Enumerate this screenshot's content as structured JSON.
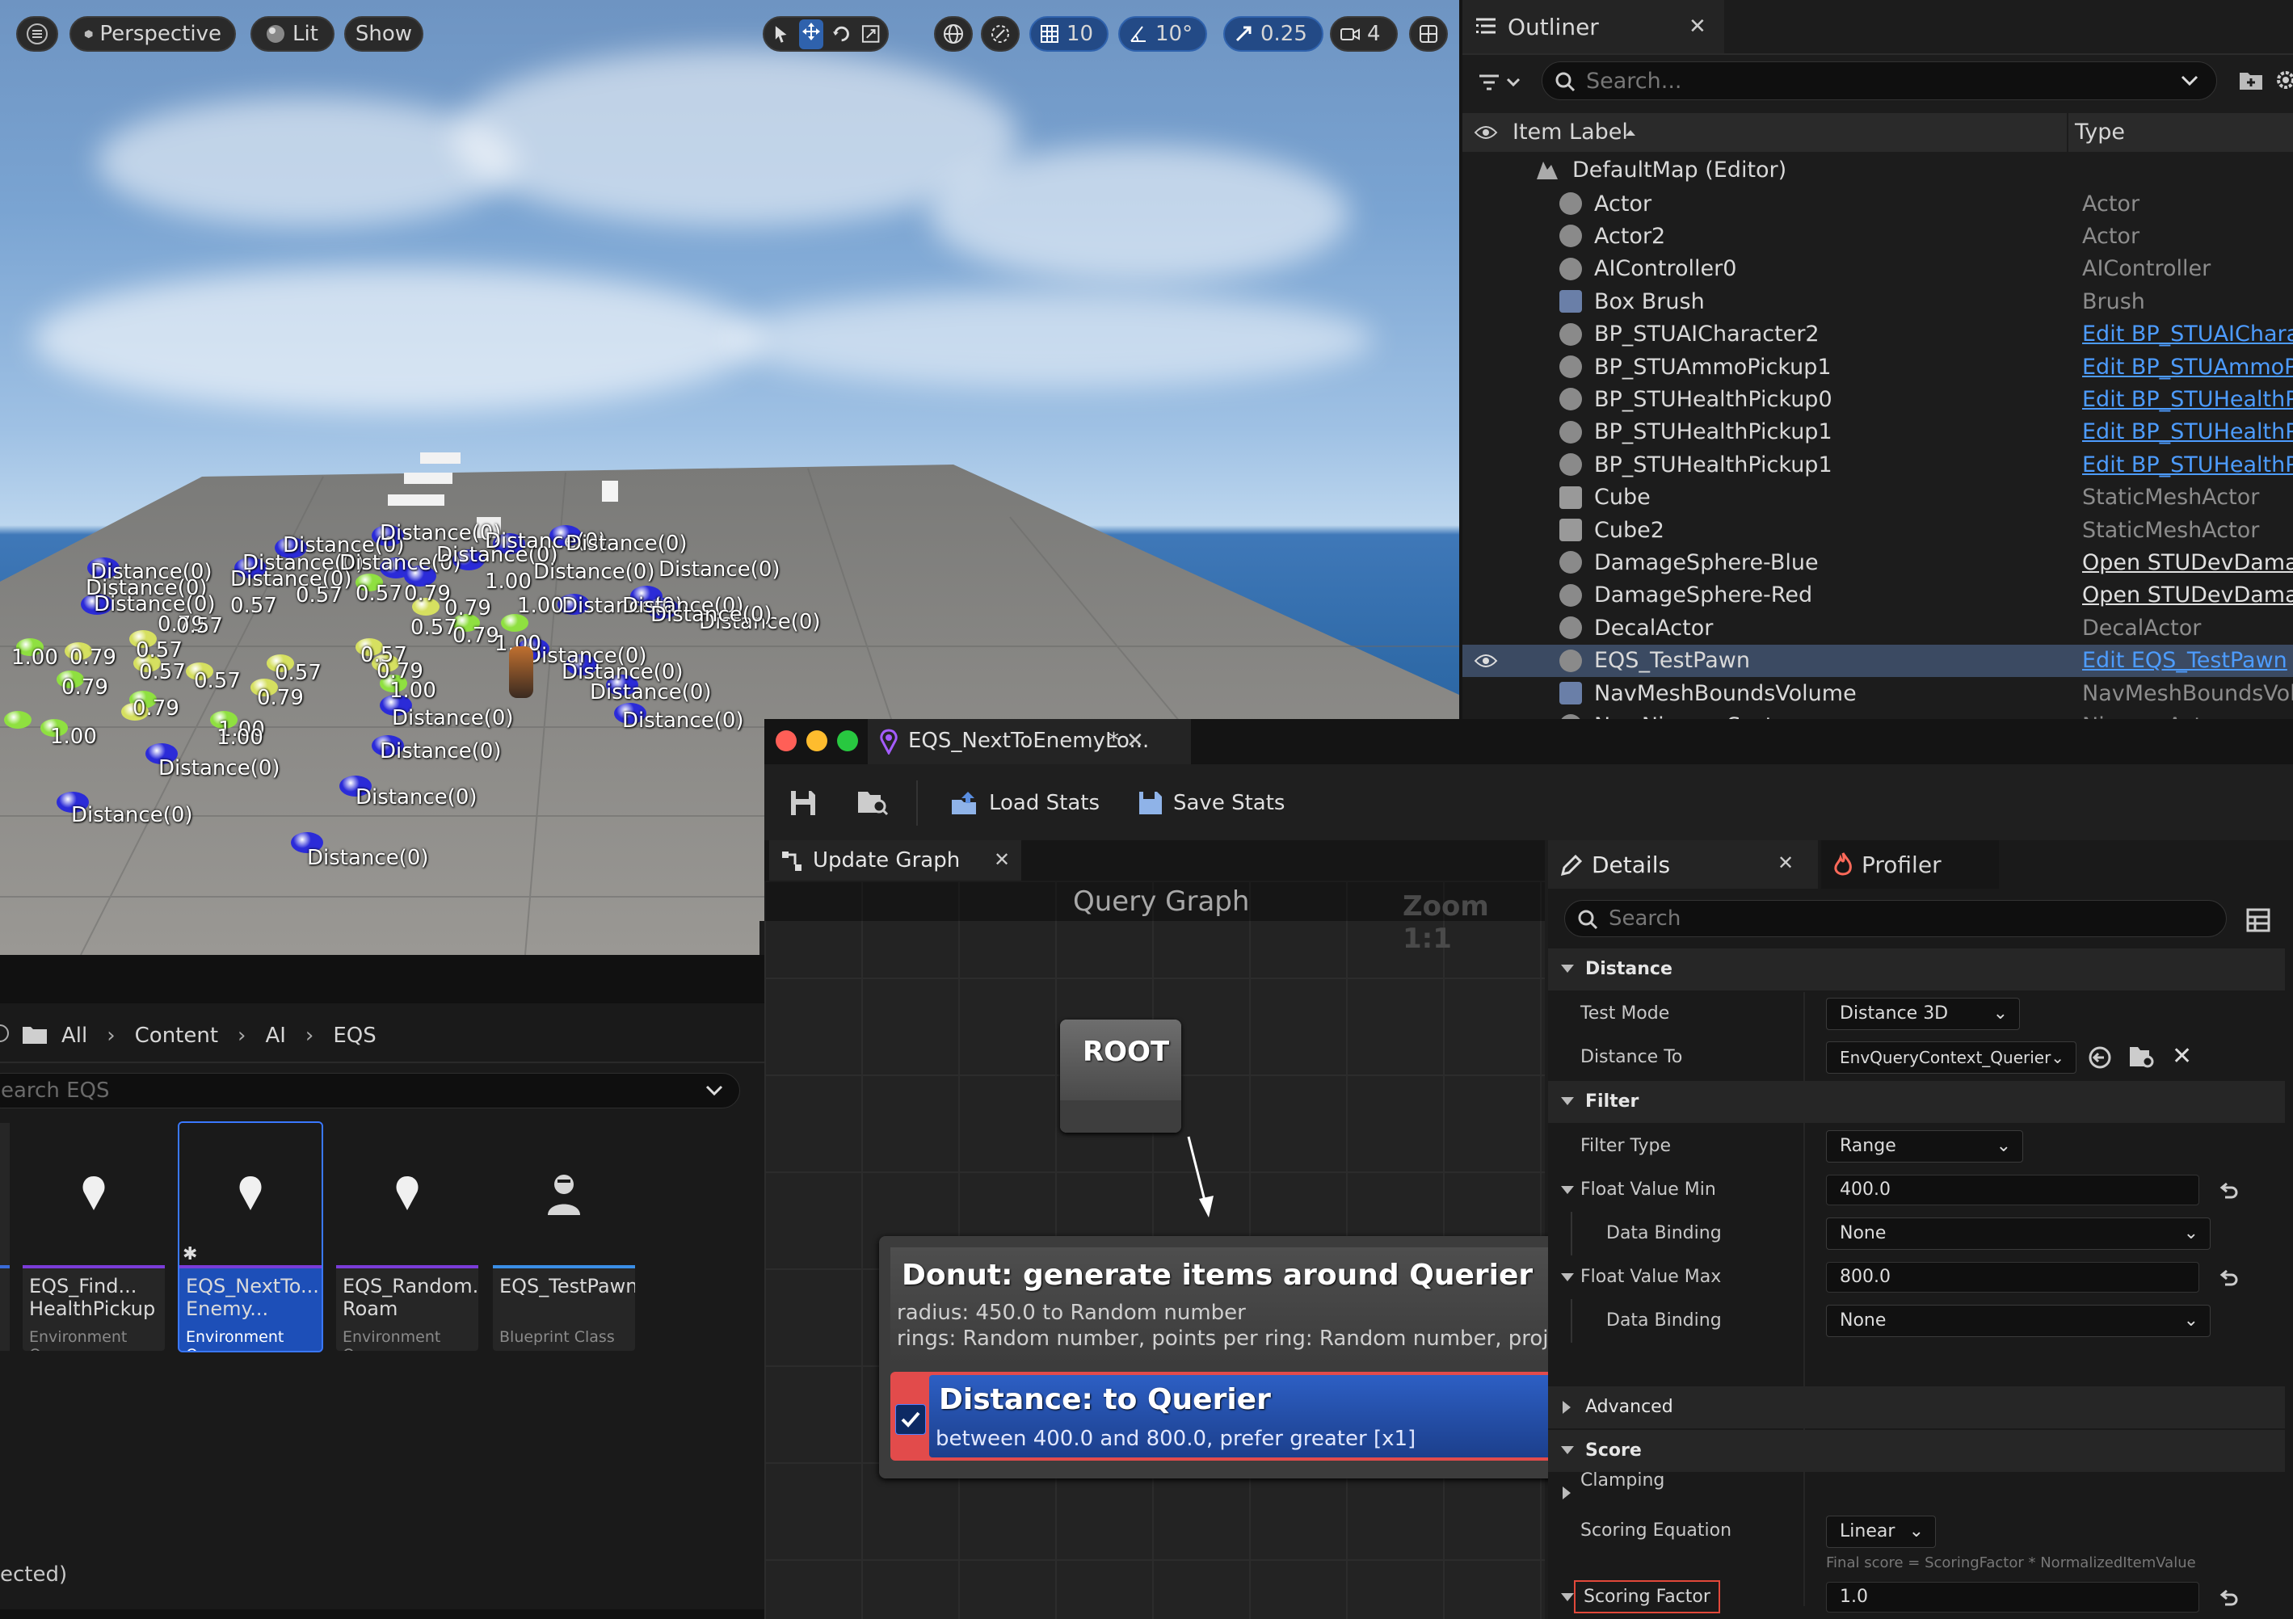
{
  "viewport": {
    "toolbar": {
      "perspective": "Perspective",
      "lit": "Lit",
      "show": "Show",
      "grid_snap": "10",
      "angle_snap": "10°",
      "scale_snap": "0.25",
      "camera_speed": "4"
    },
    "labels": {
      "distance": "Distance(0)",
      "v100": "1.00",
      "v079": "0.79",
      "v057": "0.57"
    }
  },
  "outliner": {
    "tab_title": "Outliner",
    "search_placeholder": "Search...",
    "col_label": "Item Label",
    "col_type": "Type",
    "map": "DefaultMap (Editor)",
    "rows": [
      {
        "name": "Actor",
        "type": "Actor"
      },
      {
        "name": "Actor2",
        "type": "Actor"
      },
      {
        "name": "AIController0",
        "type": "AIController"
      },
      {
        "name": "Box Brush",
        "type": "Brush"
      },
      {
        "name": "BP_STUAICharacter2",
        "type": "Edit BP_STUAICharac"
      },
      {
        "name": "BP_STUAmmoPickup1",
        "type": "Edit BP_STUAmmoPic"
      },
      {
        "name": "BP_STUHealthPickup0",
        "type": "Edit BP_STUHealthPic"
      },
      {
        "name": "BP_STUHealthPickup1",
        "type": "Edit BP_STUHealthPic"
      },
      {
        "name": "BP_STUHealthPickup1",
        "type": "Edit BP_STUHealthPic"
      },
      {
        "name": "Cube",
        "type": "StaticMeshActor"
      },
      {
        "name": "Cube2",
        "type": "StaticMeshActor"
      },
      {
        "name": "DamageSphere-Blue",
        "type": "Open STUDevDamage"
      },
      {
        "name": "DamageSphere-Red",
        "type": "Open STUDevDamage"
      },
      {
        "name": "DecalActor",
        "type": "DecalActor"
      },
      {
        "name": "EQS_TestPawn",
        "type": "Edit EQS_TestPawn"
      },
      {
        "name": "NavMeshBoundsVolume",
        "type": "NavMeshBoundsVolu"
      },
      {
        "name": "NewNiagaraSystem",
        "type": "NiagaraActor"
      }
    ]
  },
  "content": {
    "breadcrumb": [
      "All",
      "Content",
      "AI",
      "EQS"
    ],
    "search_placeholder": "earch EQS",
    "assets": [
      {
        "line1": "EQS_Find...",
        "line2": "HealthPickup",
        "type": "Environment Query"
      },
      {
        "line1": "EQS_NextTo...",
        "line2": "Enemy...",
        "type": "Environment Query"
      },
      {
        "line1": "EQS_Random...",
        "line2": "Roam",
        "type": "Environment Query"
      },
      {
        "line1": "EQS_TestPawn",
        "line2": "",
        "type": "Blueprint Class"
      }
    ],
    "status": "ected)"
  },
  "eqs": {
    "title": "EQS_NextToEnemyLo...",
    "dirty_marker": "*",
    "toolbar": {
      "load_stats": "Load Stats",
      "save_stats": "Save Stats"
    },
    "graph_tab": "Update Graph",
    "graph_title": "Query Graph",
    "zoom": "Zoom 1:1",
    "root": "ROOT",
    "generator": {
      "title": "Donut: generate items around Querier",
      "line1": "radius: 450.0 to Random number",
      "line2": "rings: Random number, points per ring: Random number, projection"
    },
    "test": {
      "title": "Distance: to Querier",
      "desc": "between 400.0 and 800.0, prefer greater [x1]"
    },
    "details": {
      "tab": "Details",
      "profiler_tab": "Profiler",
      "search_placeholder": "Search",
      "sections": {
        "distance": "Distance",
        "filter": "Filter",
        "advanced": "Advanced",
        "score": "Score"
      },
      "test_mode_label": "Test Mode",
      "test_mode": "Distance 3D",
      "distance_to_label": "Distance To",
      "distance_to": "EnvQueryContext_Querier",
      "filter_type_label": "Filter Type",
      "filter_type": "Range",
      "float_min_label": "Float Value Min",
      "float_min": "400.0",
      "data_binding_label": "Data Binding",
      "data_binding": "None",
      "float_max_label": "Float Value Max",
      "float_max": "800.0",
      "clamping_label": "Clamping",
      "scoring_eq_label": "Scoring Equation",
      "scoring_eq": "Linear",
      "final_score": "Final score = ScoringFactor * NormalizedItemValue",
      "scoring_factor_label": "Scoring Factor",
      "scoring_factor": "1.0"
    }
  }
}
